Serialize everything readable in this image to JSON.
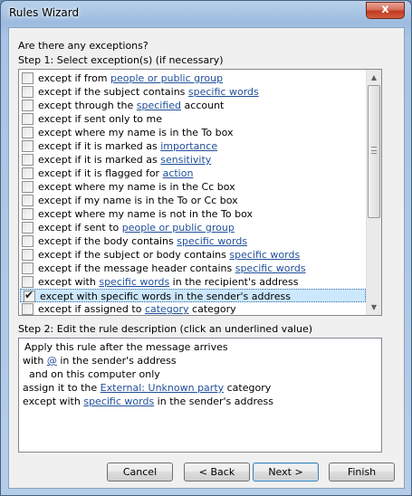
{
  "window": {
    "title": "Rules Wizard",
    "close_glyph": "x"
  },
  "heading": "Are there any exceptions?",
  "step1_label": "Step 1: Select exception(s) (if necessary)",
  "exceptions": [
    {
      "pre": "except if from ",
      "link": "people or public group",
      "post": "",
      "checked": false
    },
    {
      "pre": "except if the subject contains ",
      "link": "specific words",
      "post": "",
      "checked": false
    },
    {
      "pre": "except through the ",
      "link": "specified",
      "post": " account",
      "checked": false
    },
    {
      "pre": "except if sent only to me",
      "link": "",
      "post": "",
      "checked": false
    },
    {
      "pre": "except where my name is in the To box",
      "link": "",
      "post": "",
      "checked": false
    },
    {
      "pre": "except if it is marked as ",
      "link": "importance",
      "post": "",
      "checked": false
    },
    {
      "pre": "except if it is marked as ",
      "link": "sensitivity",
      "post": "",
      "checked": false
    },
    {
      "pre": "except if it is flagged for ",
      "link": "action",
      "post": "",
      "checked": false
    },
    {
      "pre": "except where my name is in the Cc box",
      "link": "",
      "post": "",
      "checked": false
    },
    {
      "pre": "except if my name is in the To or Cc box",
      "link": "",
      "post": "",
      "checked": false
    },
    {
      "pre": "except where my name is not in the To box",
      "link": "",
      "post": "",
      "checked": false
    },
    {
      "pre": "except if sent to ",
      "link": "people or public group",
      "post": "",
      "checked": false
    },
    {
      "pre": "except if the body contains ",
      "link": "specific words",
      "post": "",
      "checked": false
    },
    {
      "pre": "except if the subject or body contains ",
      "link": "specific words",
      "post": "",
      "checked": false
    },
    {
      "pre": "except if the message header contains ",
      "link": "specific words",
      "post": "",
      "checked": false
    },
    {
      "pre": "except with ",
      "link": "specific words",
      "post": " in the recipient's address",
      "checked": false
    },
    {
      "pre": "except with specific words in the sender's address",
      "link": "",
      "post": "",
      "checked": true,
      "selected": true
    },
    {
      "pre": "except if assigned to ",
      "link": "category",
      "post": " category",
      "checked": false
    }
  ],
  "step2_label": "Step 2: Edit the rule description (click an underlined value)",
  "description": [
    {
      "pre": "Apply this rule after the message arrives",
      "link": "",
      "post": ""
    },
    {
      "pre": "with ",
      "link": "@",
      "post": " in the sender's address"
    },
    {
      "pre": "  and on this computer only",
      "link": "",
      "post": ""
    },
    {
      "pre": "assign it to the ",
      "link": "External: Unknown party",
      "post": " category"
    },
    {
      "pre": "except with ",
      "link": "specific words",
      "post": " in the sender's address"
    }
  ],
  "buttons": {
    "cancel": "Cancel",
    "back": "< Back",
    "next": "Next >",
    "finish": "Finish"
  }
}
